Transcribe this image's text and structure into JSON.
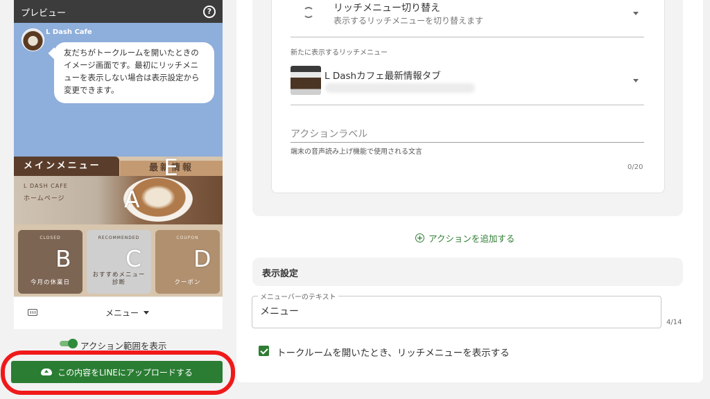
{
  "preview": {
    "title": "プレビュー",
    "help_glyph": "?",
    "bot_name": "L Dash Cafe",
    "message": "友だちがトークルームを開いたときのイメージ画面です。最初にリッチメニューを表示しない場合は表示設定から変更できます。",
    "rich_menu": {
      "tab_main": "メインメニュー",
      "tab_news": "最新情報",
      "hero_sub1": "L DASH CAFE",
      "hero_sub2": "ホームページ",
      "areas": {
        "a": "A",
        "b": "B",
        "c": "C",
        "d": "D",
        "e": "E"
      },
      "cards": [
        {
          "small": "CLOSED",
          "label": "今月の休業日"
        },
        {
          "small": "RECOMMENDED",
          "label": "おすすめメニュー\n診断"
        },
        {
          "small": "COUPON",
          "label": "クーポン"
        }
      ]
    },
    "menubar_text": "メニュー",
    "toggle_label": "アクション範囲を表示",
    "upload_label": "この内容をLINEにアップロードする"
  },
  "action": {
    "select1_title": "リッチメニュー切り替え",
    "select1_sub": "表示するリッチメニューを切り替えます",
    "select2_label": "新たに表示するリッチメニュー",
    "select2_title": "L Dashカフェ最新情報タブ",
    "action_label_placeholder": "アクションラベル",
    "action_label_help": "端末の音声読み上げ機能で使用される文言",
    "action_label_count": "0/20",
    "add_action": "アクションを追加する"
  },
  "display": {
    "title": "表示設定",
    "menubar_legend": "メニューバーのテキスト",
    "menubar_value": "メニュー",
    "menubar_count": "4/14",
    "show_on_open": "トークルームを開いたとき、リッチメニューを表示する"
  },
  "colors": {
    "accent_green": "#2e7d32",
    "highlight_red": "#f01919",
    "chat_bg": "#8eaedb"
  }
}
